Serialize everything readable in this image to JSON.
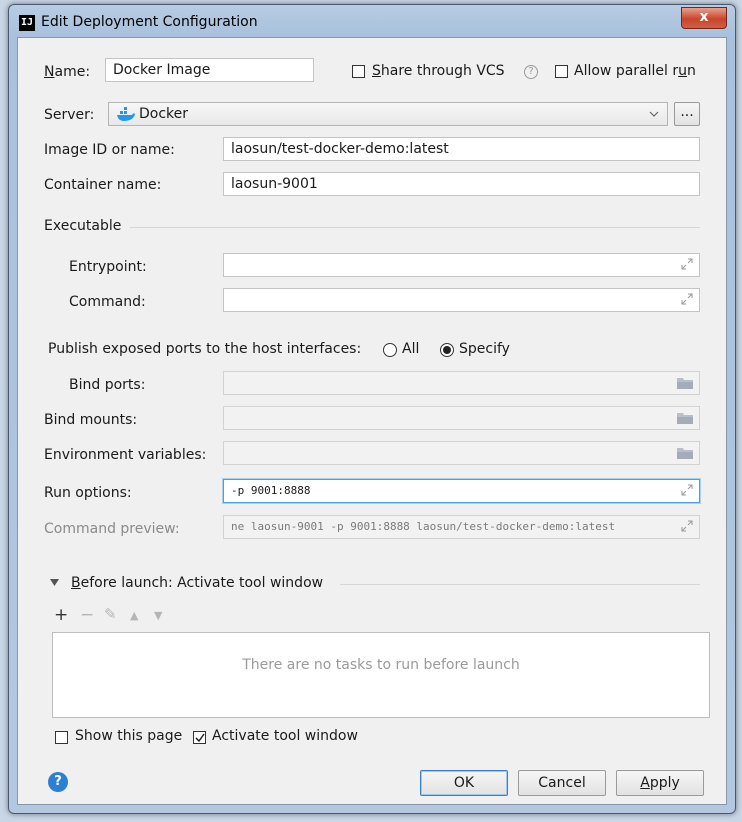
{
  "window": {
    "title": "Edit Deployment Configuration",
    "app_icon": "IJ",
    "close_glyph": "x"
  },
  "name": {
    "label_mnemonic": "N",
    "label_rest": "ame:",
    "value": "Docker Image"
  },
  "share_vcs": {
    "label_mnemonic": "S",
    "label_rest": "hare through VCS",
    "checked": false,
    "help_glyph": "?"
  },
  "allow_parallel": {
    "label_prefix": "Allow parallel r",
    "label_mnemonic": "u",
    "label_suffix": "n",
    "checked": false
  },
  "server": {
    "label": "Server:",
    "value": "Docker",
    "more_label": "..."
  },
  "image_id": {
    "label": "Image ID or name:",
    "value": "laosun/test-docker-demo:latest"
  },
  "container_name": {
    "label": "Container name:",
    "value": "laosun-9001"
  },
  "executable": {
    "heading": "Executable",
    "entrypoint_label": "Entrypoint:",
    "entrypoint_value": "",
    "command_label": "Command:",
    "command_value": ""
  },
  "publish": {
    "label": "Publish exposed ports to the host interfaces:",
    "option_all": "All",
    "option_specify": "Specify",
    "selected": "Specify"
  },
  "bind_ports": {
    "label": "Bind ports:",
    "value": ""
  },
  "bind_mounts": {
    "label": "Bind mounts:",
    "value": ""
  },
  "env_vars": {
    "label": "Environment variables:",
    "value": ""
  },
  "run_options": {
    "label": "Run options:",
    "value": "-p 9001:8888"
  },
  "command_preview": {
    "label": "Command preview:",
    "value": "ne laosun-9001 -p 9001:8888 laosun/test-docker-demo:latest"
  },
  "before_launch": {
    "heading_mnemonic": "B",
    "heading_rest": "efore launch: Activate tool window",
    "toolbar": {
      "add": "+",
      "remove": "−",
      "edit": "✎",
      "up": "▲",
      "down": "▼"
    },
    "empty_text": "There are no tasks to run before launch"
  },
  "show_page": {
    "label": "Show this page",
    "checked": false
  },
  "activate_tool": {
    "label": "Activate tool window",
    "checked": true
  },
  "buttons": {
    "ok": "OK",
    "cancel": "Cancel",
    "apply_mnemonic": "A",
    "apply_rest": "pply"
  },
  "help_glyph": "?",
  "colors": {
    "accent": "#2b80d3",
    "focus": "#4c9fd8",
    "docker": "#2496ed"
  }
}
